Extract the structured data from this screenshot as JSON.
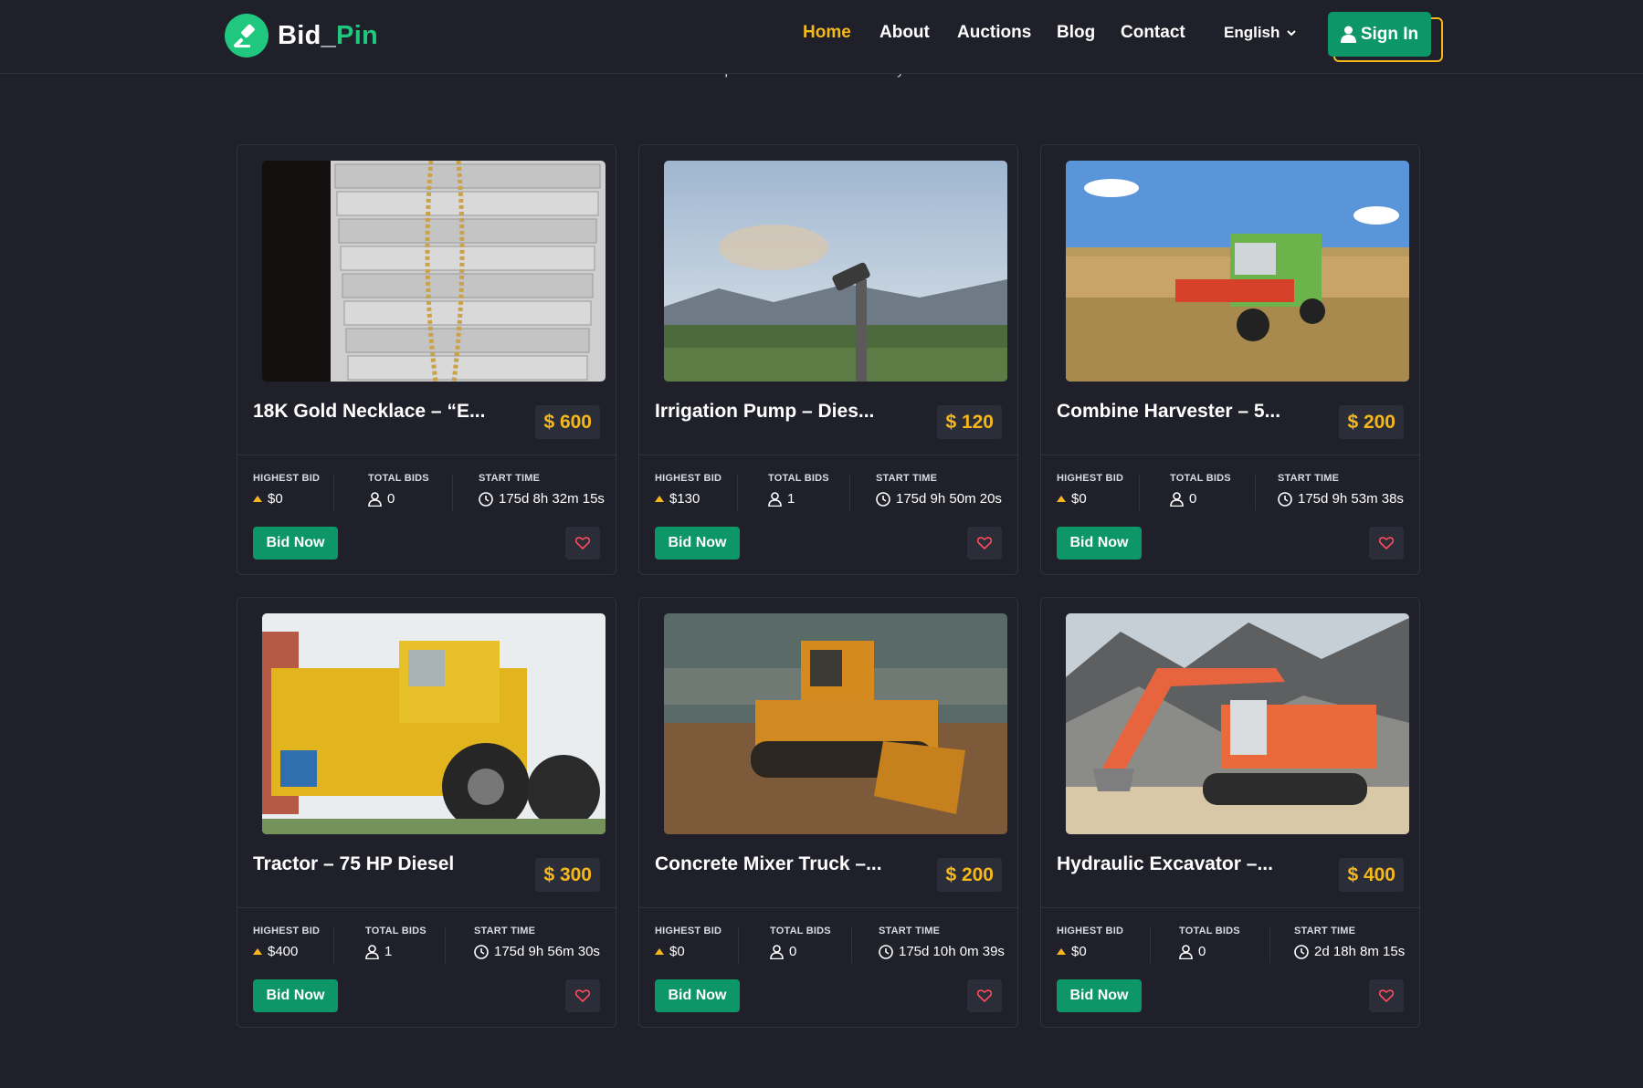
{
  "brand": {
    "name_part1": "Bid_",
    "name_part2": "Pin",
    "accent": "#1fc87e",
    "highlight": "#f5b81c"
  },
  "nav": {
    "items": [
      "Home",
      "About",
      "Auctions",
      "Blog",
      "Contact"
    ],
    "active": "Home",
    "language": "English",
    "signin_label": "Sign In"
  },
  "hero": {
    "subtext_partial": "ipsum has been the industry's"
  },
  "cards": [
    {
      "title": "18K Gold Necklace – “E...",
      "price": "$ 600",
      "highest_bid_label": "HIGHEST BID",
      "highest_bid": "$0",
      "total_bids_label": "TOTAL BIDS",
      "total_bids": "0",
      "start_time_label": "START TIME",
      "start_time": "175d 8h 32m 15s",
      "bid_label": "Bid Now",
      "image": "gold-necklace"
    },
    {
      "title": "Irrigation Pump – Dies...",
      "price": "$ 120",
      "highest_bid_label": "HIGHEST BID",
      "highest_bid": "$130",
      "total_bids_label": "TOTAL BIDS",
      "total_bids": "1",
      "start_time_label": "START TIME",
      "start_time": "175d 9h 50m 20s",
      "bid_label": "Bid Now",
      "image": "irrigation-sprinkler"
    },
    {
      "title": "Combine Harvester – 5...",
      "price": "$ 200",
      "highest_bid_label": "HIGHEST BID",
      "highest_bid": "$0",
      "total_bids_label": "TOTAL BIDS",
      "total_bids": "0",
      "start_time_label": "START TIME",
      "start_time": "175d 9h 53m 38s",
      "bid_label": "Bid Now",
      "image": "combine-harvester"
    },
    {
      "title": "Tractor – 75 HP Diesel",
      "price": "$ 300",
      "highest_bid_label": "HIGHEST BID",
      "highest_bid": "$400",
      "total_bids_label": "TOTAL BIDS",
      "total_bids": "1",
      "start_time_label": "START TIME",
      "start_time": "175d 9h 56m 30s",
      "bid_label": "Bid Now",
      "image": "yellow-tractor"
    },
    {
      "title": "Concrete Mixer Truck –...",
      "price": "$ 200",
      "highest_bid_label": "HIGHEST BID",
      "highest_bid": "$0",
      "total_bids_label": "TOTAL BIDS",
      "total_bids": "0",
      "start_time_label": "START TIME",
      "start_time": "175d 10h 0m 39s",
      "bid_label": "Bid Now",
      "image": "bulldozer"
    },
    {
      "title": "Hydraulic Excavator –...",
      "price": "$ 400",
      "highest_bid_label": "HIGHEST BID",
      "highest_bid": "$0",
      "total_bids_label": "TOTAL BIDS",
      "total_bids": "0",
      "start_time_label": "START TIME",
      "start_time": "2d 18h 8m 15s",
      "bid_label": "Bid Now",
      "image": "excavator"
    }
  ]
}
